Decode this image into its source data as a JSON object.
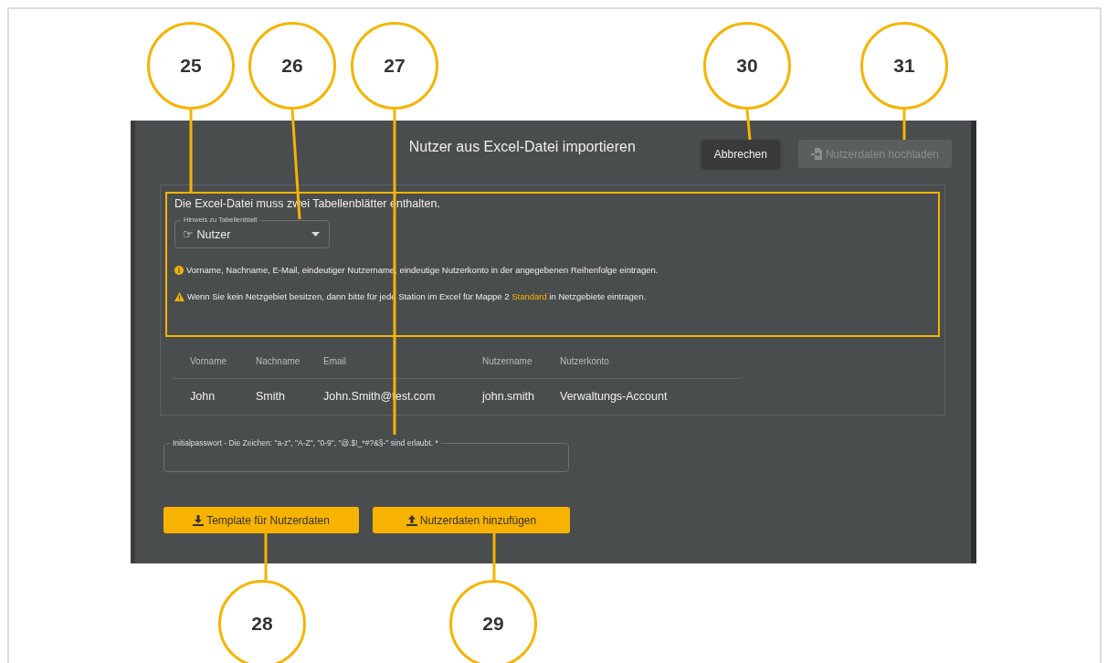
{
  "dialog": {
    "title": "Nutzer aus Excel-Datei importieren",
    "buttons": [
      {
        "label": "Abbrechen",
        "disabled": false,
        "kind": "plain"
      },
      {
        "label": "Nutzerdaten hochladen",
        "disabled": true,
        "kind": "upload-file"
      }
    ],
    "intro": "Die Excel-Datei muss zwei Tabellenblätter enthalten.",
    "sheet_select": {
      "label": "Hinweis zu Tabellenblatt",
      "value": "☞ Nutzer"
    },
    "hints": [
      {
        "kind": "info",
        "text_before": "Vorname, Nachname, E-Mail, eindeutiger Nutzername, eindeutige Nutzerkonto in der angegebenen Reihenfolge eintragen."
      },
      {
        "kind": "warning",
        "text_before": "Wenn Sie kein Netzgebiet besitzen, dann bitte für jede Station im Excel für Mappe 2 ",
        "link": "Standard",
        "text_after": " in Netzgebiete eintragen."
      }
    ],
    "table": {
      "columns": [
        "Vorname",
        "Nachname",
        "Email",
        "Nutzername",
        "Nutzerkonto"
      ],
      "rows": [
        [
          "John",
          "Smith",
          "John.Smith@test.com",
          "john.smith",
          "Verwaltungs-Account"
        ]
      ]
    },
    "password_field": {
      "label": "Initialpasswort - Die Zeichen: \"a-z\", \"A-Z\", \"0-9\", \"@.$!_*#?&§-\" sind erlaubt. *"
    },
    "action_buttons": [
      {
        "label": "Template für Nutzerdaten",
        "kind": "download"
      },
      {
        "label": "Nutzerdaten hinzufügen",
        "kind": "upload"
      }
    ]
  },
  "callouts": [
    {
      "number": "25"
    },
    {
      "number": "26"
    },
    {
      "number": "27"
    },
    {
      "number": "30"
    },
    {
      "number": "31"
    },
    {
      "number": "28"
    },
    {
      "number": "29"
    }
  ]
}
